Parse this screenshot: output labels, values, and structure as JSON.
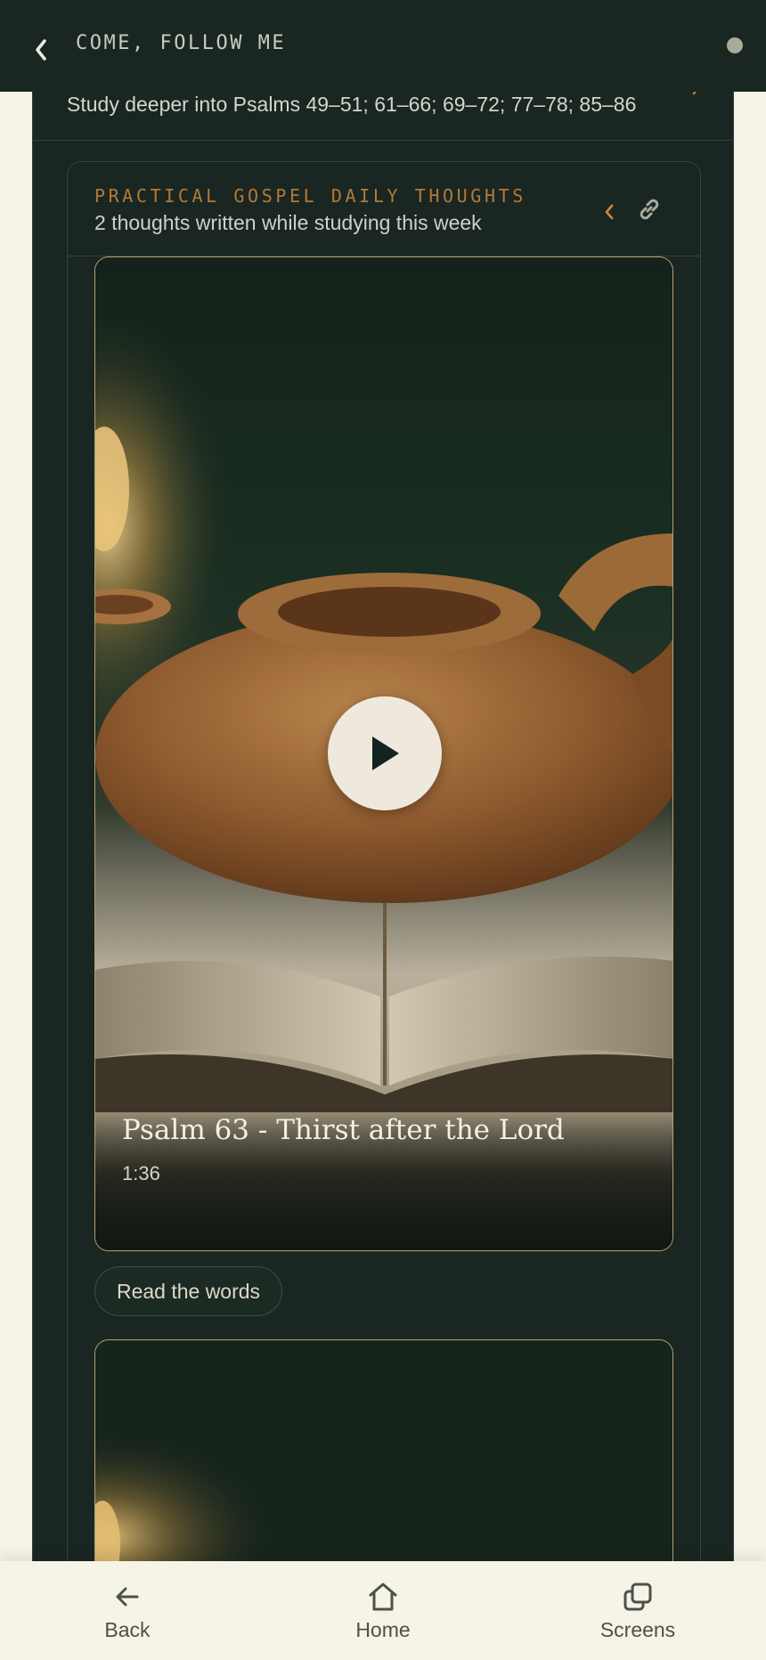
{
  "header": {
    "back_icon": "chevron-left-icon",
    "title": "COME, FOLLOW ME",
    "status_icon": "dot-icon"
  },
  "study": {
    "text": "Study deeper into Psalms 49–51; 61–66; 69–72; 77–78; 85–86"
  },
  "card": {
    "kicker": "PRACTICAL GOSPEL DAILY THOUGHTS",
    "subtitle": "2 thoughts written while studying this week",
    "collapse_icon": "chevron-left-icon",
    "link_icon": "link-icon",
    "videos": [
      {
        "title": "Psalm 63 - Thirst after the Lord",
        "duration": "1:36",
        "play_icon": "play-icon"
      }
    ],
    "read_button": "Read the words"
  },
  "colors": {
    "panel": "#192621",
    "accent": "#b27a37",
    "cream": "#f5f2e8"
  },
  "bottom_nav": {
    "items": [
      {
        "label": "Back",
        "icon": "arrow-left-icon"
      },
      {
        "label": "Home",
        "icon": "home-icon"
      },
      {
        "label": "Screens",
        "icon": "screens-icon"
      }
    ]
  }
}
